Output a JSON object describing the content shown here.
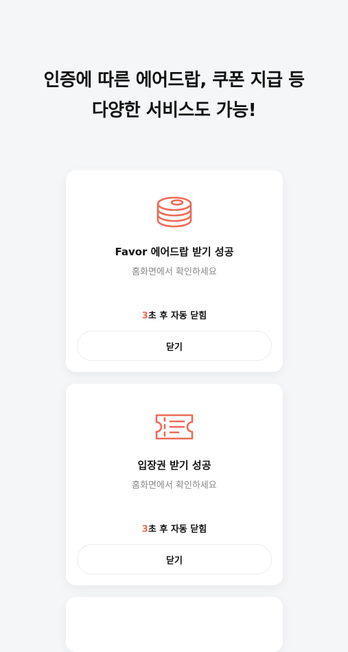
{
  "headline": {
    "line1": "인증에 따른 에어드랍, 쿠폰 지급 등",
    "line2": "다양한 서비스도 가능!"
  },
  "accent_color": "#ee6a55",
  "cards": [
    {
      "icon": "coins-icon",
      "title": "Favor 에어드랍 받기 성공",
      "subtitle": "홈화면에서 확인하세요",
      "countdown_num": "3",
      "countdown_text": "초 후 자동 닫힘",
      "close_label": "닫기"
    },
    {
      "icon": "ticket-icon",
      "title": "입장권 받기 성공",
      "subtitle": "홈화면에서 확인하세요",
      "countdown_num": "3",
      "countdown_text": "초 후 자동 닫힘",
      "close_label": "닫기"
    }
  ]
}
